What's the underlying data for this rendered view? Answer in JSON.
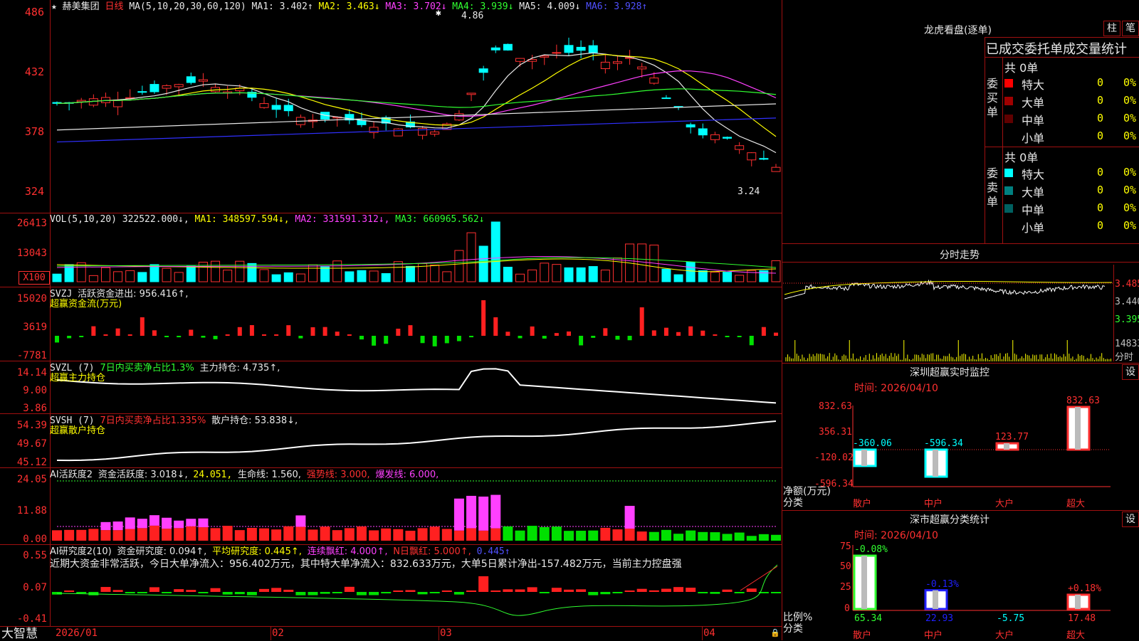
{
  "main": {
    "stock_name": "赫美集团",
    "period": "日线",
    "ma_title": "MA(5,10,20,30,60,120)",
    "ma_values": [
      {
        "label": "MA1:",
        "value": "3.402↑",
        "color": "#e8e8e8"
      },
      {
        "label": "MA2:",
        "value": "3.463↓",
        "color": "#ffff00"
      },
      {
        "label": "MA3:",
        "value": "3.702↓",
        "color": "#ff40ff"
      },
      {
        "label": "MA4:",
        "value": "3.939↓",
        "color": "#30ff30"
      },
      {
        "label": "MA5:",
        "value": "4.009↓",
        "color": "#e8e8e8"
      },
      {
        "label": "MA6:",
        "value": "3.928↑",
        "color": "#5050ff"
      }
    ],
    "high_mark": "4.86",
    "low_mark": "3.24",
    "y_ticks": [
      "486",
      "432",
      "378",
      "324"
    ]
  },
  "vol": {
    "title": "VOL(5,10,20)",
    "current": "322522.000↓,",
    "ma1": "MA1: 348597.594↓,",
    "ma2": "MA2: 331591.312↓,",
    "ma3": "MA3: 660965.562↓",
    "y_ticks": [
      "26413",
      "13043"
    ],
    "unit": "X100"
  },
  "svzj": {
    "title": "SVZJ",
    "label": "活跃资金进出: 956.416↑,",
    "sub": "超赢资金流(万元)",
    "y_ticks": [
      "15020",
      "3619",
      "-7781"
    ]
  },
  "svzl": {
    "title": "SVZL (7)",
    "ratio": "7日内买卖净占比1.3%",
    "hold": "主力持仓: 4.735↑,",
    "sub": "超赢主力持仓",
    "y_ticks": [
      "14.14",
      "9.00",
      "3.86"
    ]
  },
  "svsh": {
    "title": "SVSH (7)",
    "ratio": "7日内买卖净占比1.335%",
    "hold": "散户持仓: 53.838↓,",
    "sub": "超赢散户持仓",
    "y_ticks": [
      "54.39",
      "49.67",
      "45.12"
    ]
  },
  "ai1": {
    "title": "AI活跃度2",
    "active": "资金活跃度: 3.018↓,",
    "v2": "24.051,",
    "life": "生命线: 1.560,",
    "strong": "强势线: 3.000,",
    "burst": "爆发线: 6.000,",
    "y_ticks": [
      "24.05",
      "11.88",
      "0.00"
    ]
  },
  "ai2": {
    "title": "AI研究度2(10)",
    "research": "资金研究度: 0.094↑,",
    "avg": "平均研究度: 0.445↑,",
    "cont": "连续飘红: 4.000↑,",
    "nday": "N日飘红: 5.000↑,",
    "last": "0.445↑",
    "comment": "近期大资金非常活跃，今日大单净流入：956.402万元，其中特大单净流入：832.633万元，大单5日累计净出-157.482万元，当前主力控盘强",
    "y_ticks": [
      "0.55",
      "0.07",
      "-0.41"
    ]
  },
  "xaxis": {
    "logo": "大智慧",
    "labels": [
      "2026/01",
      "02",
      "03",
      "04"
    ]
  },
  "right": {
    "lhb_title": "龙虎看盘(逐单)",
    "btn_bar": "柱",
    "btn_pen": "笔",
    "stats_header": "已成交委托单成交量统计",
    "buy": {
      "side_label": "委买单",
      "total": "共 0单",
      "rows": [
        {
          "name": "特大",
          "count": "0",
          "pct": "0%",
          "color": "#ff0000"
        },
        {
          "name": "大单",
          "count": "0",
          "pct": "0%",
          "color": "#a00000"
        },
        {
          "name": "中单",
          "count": "0",
          "pct": "0%",
          "color": "#600000"
        },
        {
          "name": "小单",
          "count": "0",
          "pct": "0%",
          "color": "#000000"
        }
      ]
    },
    "sell": {
      "side_label": "委卖单",
      "total": "共 0单",
      "rows": [
        {
          "name": "特大",
          "count": "0",
          "pct": "0%",
          "color": "#00ffff"
        },
        {
          "name": "大单",
          "count": "0",
          "pct": "0%",
          "color": "#008080"
        },
        {
          "name": "中单",
          "count": "0",
          "pct": "0%",
          "color": "#006060"
        },
        {
          "name": "小单",
          "count": "0",
          "pct": "0%",
          "color": "#000000"
        }
      ]
    },
    "intraday": {
      "title": "分时走势",
      "prices": [
        "3.485",
        "3.440",
        "3.395"
      ],
      "vol": "14833",
      "vol_unit": "分时"
    },
    "monitor": {
      "title": "深圳超赢实时监控",
      "btn": "设",
      "time": "时间: 2026/04/10",
      "y_ticks": [
        "832.63",
        "356.31",
        "-120.02",
        "-596.34"
      ],
      "ylabel": "净额(万元)",
      "xlabel": "分类"
    },
    "classify": {
      "title": "深市超赢分类统计",
      "btn": "设",
      "time": "时间: 2026/04/10",
      "y_ticks": [
        "75",
        "50",
        "25",
        "0"
      ],
      "ylabel": "比例%",
      "xlabel": "分类"
    }
  },
  "chart_data": [
    {
      "type": "bar",
      "title": "深圳超赢实时监控",
      "categories": [
        "散户",
        "中户",
        "大户",
        "超大"
      ],
      "values": [
        -360.06,
        -596.34,
        123.77,
        832.63
      ],
      "ylim": [
        -596.34,
        832.63
      ],
      "ylabel": "净额(万元)",
      "xlabel": "分类"
    },
    {
      "type": "bar",
      "title": "深市超赢分类统计",
      "categories": [
        "散户",
        "中户",
        "大户",
        "超大"
      ],
      "values": [
        65.34,
        22.93,
        -5.75,
        17.48
      ],
      "top_labels": [
        "-0.08%",
        "-0.13%",
        "",
        "+0.18%"
      ],
      "ylim": [
        0,
        75
      ],
      "ylabel": "比例%",
      "xlabel": "分类"
    }
  ]
}
